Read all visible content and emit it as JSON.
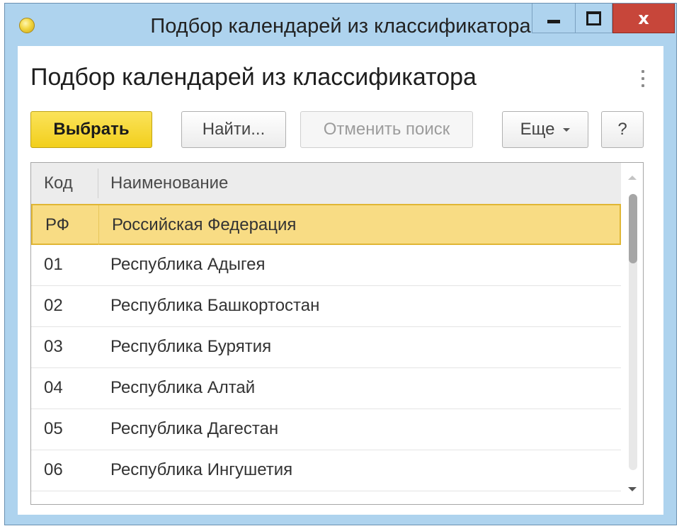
{
  "window": {
    "title": "Подбор календарей из классификатора",
    "minimize_icon": "minimize-icon",
    "maximize_icon": "maximize-icon",
    "close_label": "x"
  },
  "form": {
    "heading": "Подбор календарей из классификатора",
    "menu_icon": "kebab-menu-icon"
  },
  "toolbar": {
    "select_label": "Выбрать",
    "find_label": "Найти...",
    "cancel_search_label": "Отменить поиск",
    "more_label": "Еще",
    "help_label": "?"
  },
  "table": {
    "columns": {
      "code": "Код",
      "name": "Наименование"
    },
    "rows": [
      {
        "code": "РФ",
        "name": "Российская Федерация",
        "selected": true
      },
      {
        "code": "01",
        "name": "Республика Адыгея"
      },
      {
        "code": "02",
        "name": "Республика Башкортостан"
      },
      {
        "code": "03",
        "name": "Республика Бурятия"
      },
      {
        "code": "04",
        "name": "Республика Алтай"
      },
      {
        "code": "05",
        "name": "Республика Дагестан"
      },
      {
        "code": "06",
        "name": "Республика Ингушетия"
      }
    ]
  },
  "colors": {
    "titlebar": "#aed3ee",
    "close_button": "#c7463a",
    "accent_button": "#f2cf1c",
    "selected_row": "#f8dc84"
  }
}
